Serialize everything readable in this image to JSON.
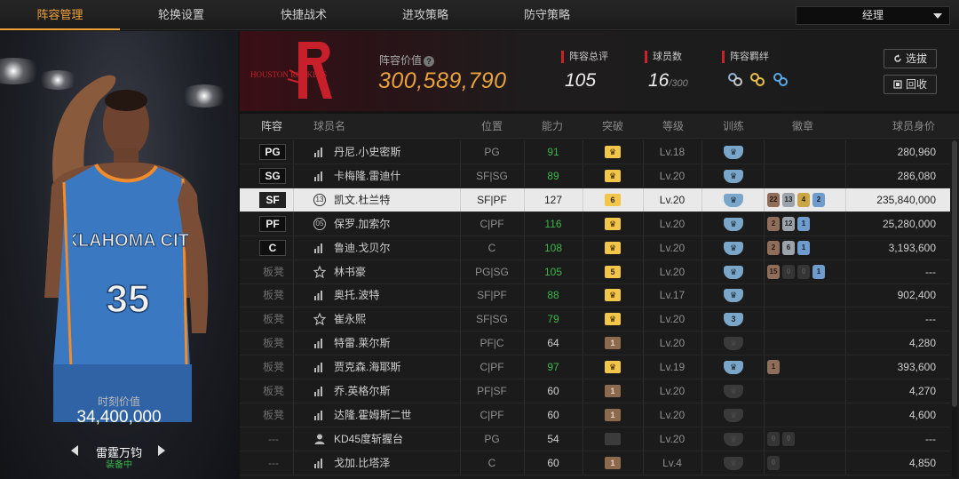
{
  "nav": {
    "tabs": [
      "阵容管理",
      "轮换设置",
      "快捷战术",
      "进攻策略",
      "防守策略"
    ],
    "active_tab": "阵容管理",
    "role_select": "经理"
  },
  "left_panel": {
    "moment_label": "时刻价值",
    "moment_value": "34,400,000",
    "card_name": "雷霆万钧",
    "card_status": "装备中",
    "jersey_team": "OKLAHOMA CITY",
    "jersey_number": "35"
  },
  "header": {
    "logo_text": "HOUSTON ROCKETS",
    "lineup_value_label": "阵容价值",
    "lineup_value": "300,589,790",
    "total_rating_label": "阵容总评",
    "total_rating": "105",
    "players_label": "球员数",
    "players_count": "16",
    "players_max": "/300",
    "bond_label": "阵容羁绊",
    "bond_icons": [
      "team-bond-icon",
      "gold-bond-icon",
      "blue-bond-icon"
    ],
    "btn_scout": "选拔",
    "btn_return": "回收"
  },
  "table": {
    "headers": [
      "阵容",
      "球员名",
      "位置",
      "能力",
      "突破",
      "等级",
      "训练",
      "徽章",
      "球员身价"
    ],
    "rows": [
      {
        "slot": "PG",
        "starter": true,
        "icon": "signal",
        "name": "丹尼.小史密斯",
        "position": "PG",
        "ability": "91",
        "ability_green": true,
        "breakthrough": {
          "type": "gold",
          "text": "♛"
        },
        "level": "Lv.18",
        "training": {
          "type": "blue",
          "text": "♛"
        },
        "badges": [],
        "value": "280,960"
      },
      {
        "slot": "SG",
        "starter": true,
        "icon": "signal",
        "name": "卡梅隆.雷迪什",
        "position": "SF|SG",
        "ability": "89",
        "ability_green": true,
        "breakthrough": {
          "type": "gold",
          "text": "♛"
        },
        "level": "Lv.20",
        "training": {
          "type": "blue",
          "text": "♛"
        },
        "badges": [],
        "value": "286,080"
      },
      {
        "slot": "SF",
        "starter": true,
        "selected": true,
        "icon": "13",
        "name": "凯文.杜兰特",
        "position": "SF|PF",
        "ability": "127",
        "ability_green": false,
        "breakthrough": {
          "type": "gold",
          "text": "6"
        },
        "level": "Lv.20",
        "training": {
          "type": "blue",
          "text": "♛"
        },
        "badges": [
          {
            "t": "bronze",
            "v": "22"
          },
          {
            "t": "silver",
            "v": "13"
          },
          {
            "t": "gold",
            "v": "4"
          },
          {
            "t": "blue",
            "v": "2"
          }
        ],
        "value": "235,840,000"
      },
      {
        "slot": "PF",
        "starter": true,
        "icon": "05",
        "name": "保罗.加索尔",
        "position": "C|PF",
        "ability": "116",
        "ability_green": true,
        "breakthrough": {
          "type": "gold",
          "text": "♛"
        },
        "level": "Lv.20",
        "training": {
          "type": "blue",
          "text": "♛"
        },
        "badges": [
          {
            "t": "bronze",
            "v": "2"
          },
          {
            "t": "silver",
            "v": "12"
          },
          {
            "t": "blue",
            "v": "1"
          }
        ],
        "value": "25,280,000"
      },
      {
        "slot": "C",
        "starter": true,
        "icon": "signal",
        "name": "鲁迪.戈贝尔",
        "position": "C",
        "ability": "108",
        "ability_green": true,
        "breakthrough": {
          "type": "gold",
          "text": "♛"
        },
        "level": "Lv.20",
        "training": {
          "type": "blue",
          "text": "♛"
        },
        "badges": [
          {
            "t": "bronze",
            "v": "2"
          },
          {
            "t": "silver",
            "v": "6"
          },
          {
            "t": "blue",
            "v": "1"
          }
        ],
        "value": "3,193,600"
      },
      {
        "slot": "板凳",
        "starter": false,
        "icon": "star",
        "name": "林书豪",
        "position": "PG|SG",
        "ability": "105",
        "ability_green": true,
        "breakthrough": {
          "type": "gold",
          "text": "5"
        },
        "level": "Lv.20",
        "training": {
          "type": "blue",
          "text": "♛"
        },
        "badges": [
          {
            "t": "bronze",
            "v": "15"
          },
          {
            "t": "dark",
            "v": "0"
          },
          {
            "t": "dark",
            "v": "0"
          },
          {
            "t": "blue",
            "v": "1"
          }
        ],
        "value": "---"
      },
      {
        "slot": "板凳",
        "starter": false,
        "icon": "signal",
        "name": "奥托.波特",
        "position": "SF|PF",
        "ability": "88",
        "ability_green": true,
        "breakthrough": {
          "type": "gold",
          "text": "♛"
        },
        "level": "Lv.17",
        "training": {
          "type": "blue",
          "text": "♛"
        },
        "badges": [],
        "value": "902,400"
      },
      {
        "slot": "板凳",
        "starter": false,
        "icon": "star",
        "name": "崔永熙",
        "position": "SF|SG",
        "ability": "79",
        "ability_green": true,
        "breakthrough": {
          "type": "gold",
          "text": "♛"
        },
        "level": "Lv.20",
        "training": {
          "type": "blue",
          "text": "3"
        },
        "badges": [],
        "value": "---"
      },
      {
        "slot": "板凳",
        "starter": false,
        "icon": "signal",
        "name": "特雷.莱尔斯",
        "position": "PF|C",
        "ability": "64",
        "ability_green": false,
        "breakthrough": {
          "type": "brown",
          "text": "1"
        },
        "level": "Lv.20",
        "training": {
          "type": "dark",
          "text": "♛"
        },
        "badges": [],
        "value": "4,280"
      },
      {
        "slot": "板凳",
        "starter": false,
        "icon": "signal",
        "name": "贾克森.海耶斯",
        "position": "C|PF",
        "ability": "97",
        "ability_green": true,
        "breakthrough": {
          "type": "gold",
          "text": "♛"
        },
        "level": "Lv.19",
        "training": {
          "type": "blue",
          "text": "♛"
        },
        "badges": [
          {
            "t": "bronze",
            "v": "1"
          }
        ],
        "value": "393,600"
      },
      {
        "slot": "板凳",
        "starter": false,
        "icon": "signal",
        "name": "乔.英格尔斯",
        "position": "PF|SF",
        "ability": "60",
        "ability_green": false,
        "breakthrough": {
          "type": "brown",
          "text": "1"
        },
        "level": "Lv.20",
        "training": {
          "type": "dark",
          "text": "♛"
        },
        "badges": [],
        "value": "4,270"
      },
      {
        "slot": "板凳",
        "starter": false,
        "icon": "signal",
        "name": "达隆.霍姆斯二世",
        "position": "C|PF",
        "ability": "60",
        "ability_green": false,
        "breakthrough": {
          "type": "brown",
          "text": "1"
        },
        "level": "Lv.20",
        "training": {
          "type": "dark",
          "text": "♛"
        },
        "badges": [],
        "value": "4,600"
      },
      {
        "slot": "---",
        "starter": false,
        "icon": "person",
        "name": "KD45度斩握台",
        "position": "PG",
        "ability": "54",
        "ability_green": false,
        "breakthrough": {
          "type": "dark",
          "text": ""
        },
        "level": "Lv.20",
        "training": {
          "type": "dark",
          "text": "♛"
        },
        "badges": [
          {
            "t": "dark",
            "v": "0"
          },
          {
            "t": "dark",
            "v": "0"
          }
        ],
        "value": "---"
      },
      {
        "slot": "---",
        "starter": false,
        "icon": "signal",
        "name": "戈加.比塔泽",
        "position": "C",
        "ability": "60",
        "ability_green": false,
        "breakthrough": {
          "type": "brown",
          "text": "1"
        },
        "level": "Lv.4",
        "training": {
          "type": "dark",
          "text": "♛"
        },
        "badges": [
          {
            "t": "dark",
            "v": "0"
          }
        ],
        "value": "4,850"
      }
    ]
  },
  "colors": {
    "accent_orange": "#f0a23a",
    "value_gold": "#e8a23c",
    "stat_red": "#c8232c",
    "ability_green": "#3ab54a",
    "selected_row": "#e9e9e9"
  }
}
